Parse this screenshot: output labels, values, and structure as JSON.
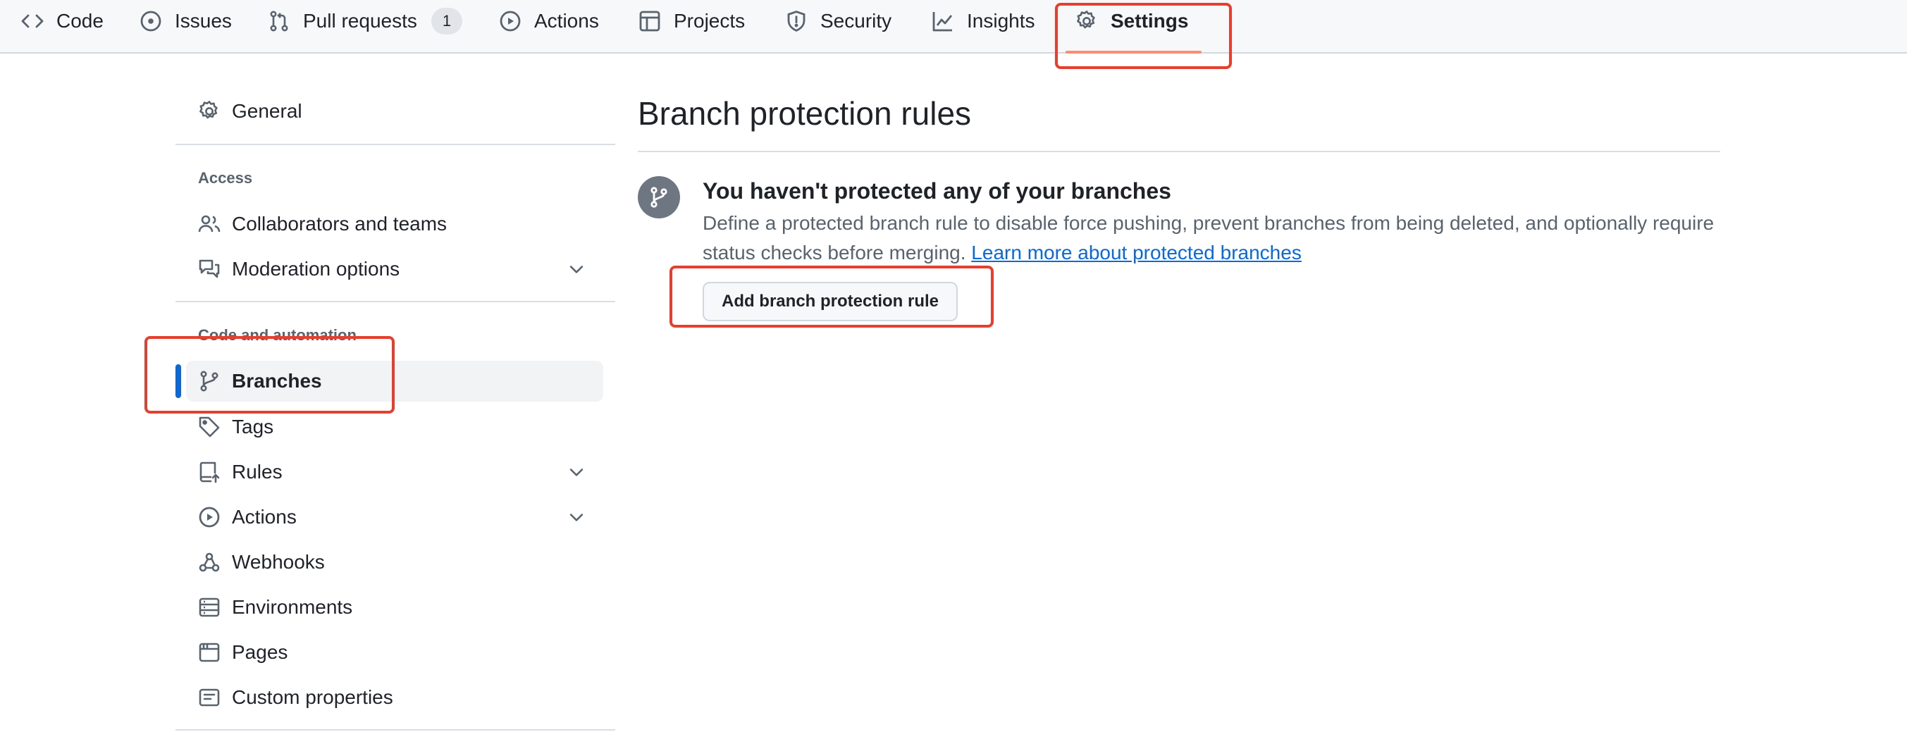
{
  "topnav": {
    "code": "Code",
    "issues": "Issues",
    "pull_requests": "Pull requests",
    "pull_requests_count": "1",
    "actions": "Actions",
    "projects": "Projects",
    "security": "Security",
    "insights": "Insights",
    "settings": "Settings"
  },
  "sidebar": {
    "general": "General",
    "access_heading": "Access",
    "collaborators": "Collaborators and teams",
    "moderation": "Moderation options",
    "code_automation_heading": "Code and automation",
    "branches": "Branches",
    "tags": "Tags",
    "rules": "Rules",
    "actions": "Actions",
    "webhooks": "Webhooks",
    "environments": "Environments",
    "pages": "Pages",
    "custom_properties": "Custom properties"
  },
  "main": {
    "title": "Branch protection rules",
    "blank_heading": "You haven't protected any of your branches",
    "blank_desc": "Define a protected branch rule to disable force pushing, prevent branches from being deleted, and optionally require status checks before merging.",
    "learn_more": "Learn more about protected branches",
    "add_button": "Add branch protection rule"
  },
  "colors": {
    "accent": "#0969da",
    "active_tab_underline": "#fd8c73",
    "highlight": "#e5402f"
  }
}
